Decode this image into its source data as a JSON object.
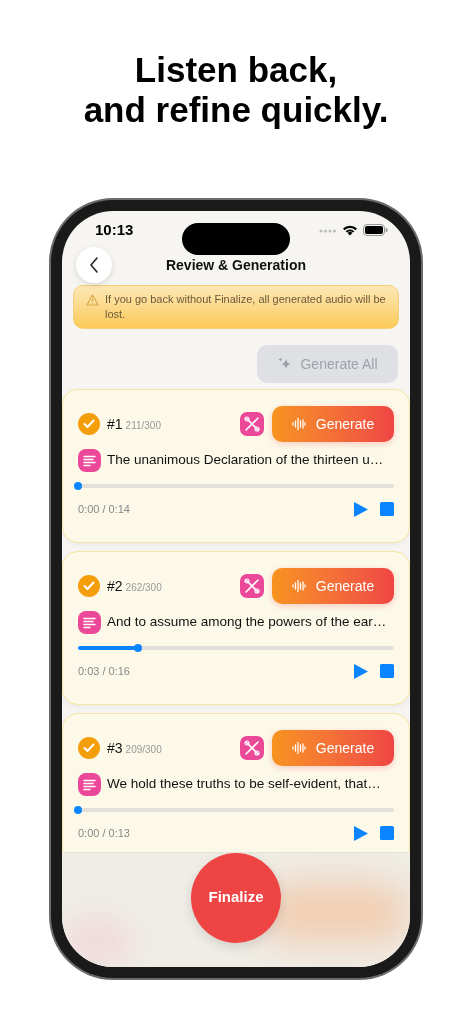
{
  "headline": [
    "Listen back,",
    "and refine quickly."
  ],
  "status_bar": {
    "time": "10:13"
  },
  "nav": {
    "title": "Review & Generation"
  },
  "warning": {
    "text": "If you go back without Finalize, all generated audio will be lost."
  },
  "generate_all": {
    "label": "Generate All",
    "disabled": true
  },
  "items": [
    {
      "number": "#1",
      "count": "211/300",
      "checked": true,
      "text": "The unanimous Declaration of the thirteen u…",
      "level": 0.0,
      "time": "0:00 / 0:14",
      "generate": "Generate"
    },
    {
      "number": "#2",
      "count": "262/300",
      "checked": true,
      "text": "And to assume among the powers of the ear…",
      "level": 0.19,
      "time": "0:03 / 0:16",
      "generate": "Generate"
    },
    {
      "number": "#3",
      "count": "209/300",
      "checked": true,
      "text": "We hold these truths to be self-evident, that…",
      "level": 0.0,
      "time": "0:00 / 0:13",
      "generate": "Generate"
    }
  ],
  "finalize": {
    "label": "Finalize"
  }
}
